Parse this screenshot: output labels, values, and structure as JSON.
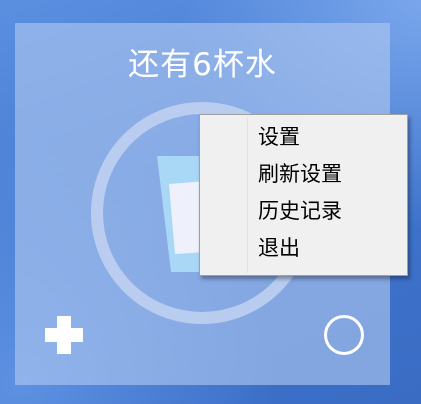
{
  "widget": {
    "title": "还有6杯水",
    "progress_fraction": 0.0
  },
  "controls": {
    "add_icon": "plus-icon",
    "reset_icon": "circle-icon"
  },
  "context_menu": {
    "items": [
      {
        "label": "设置"
      },
      {
        "label": "刷新设置"
      },
      {
        "label": "历史记录"
      },
      {
        "label": "退出"
      }
    ]
  },
  "colors": {
    "widget_panel": "#b0c8f0",
    "ring": "#c5d6f3",
    "cup_body": "#a9d8f7",
    "cup_liquid": "#eef1fb",
    "menu_background": "#f0f0f0",
    "accent_white": "#ffffff"
  }
}
